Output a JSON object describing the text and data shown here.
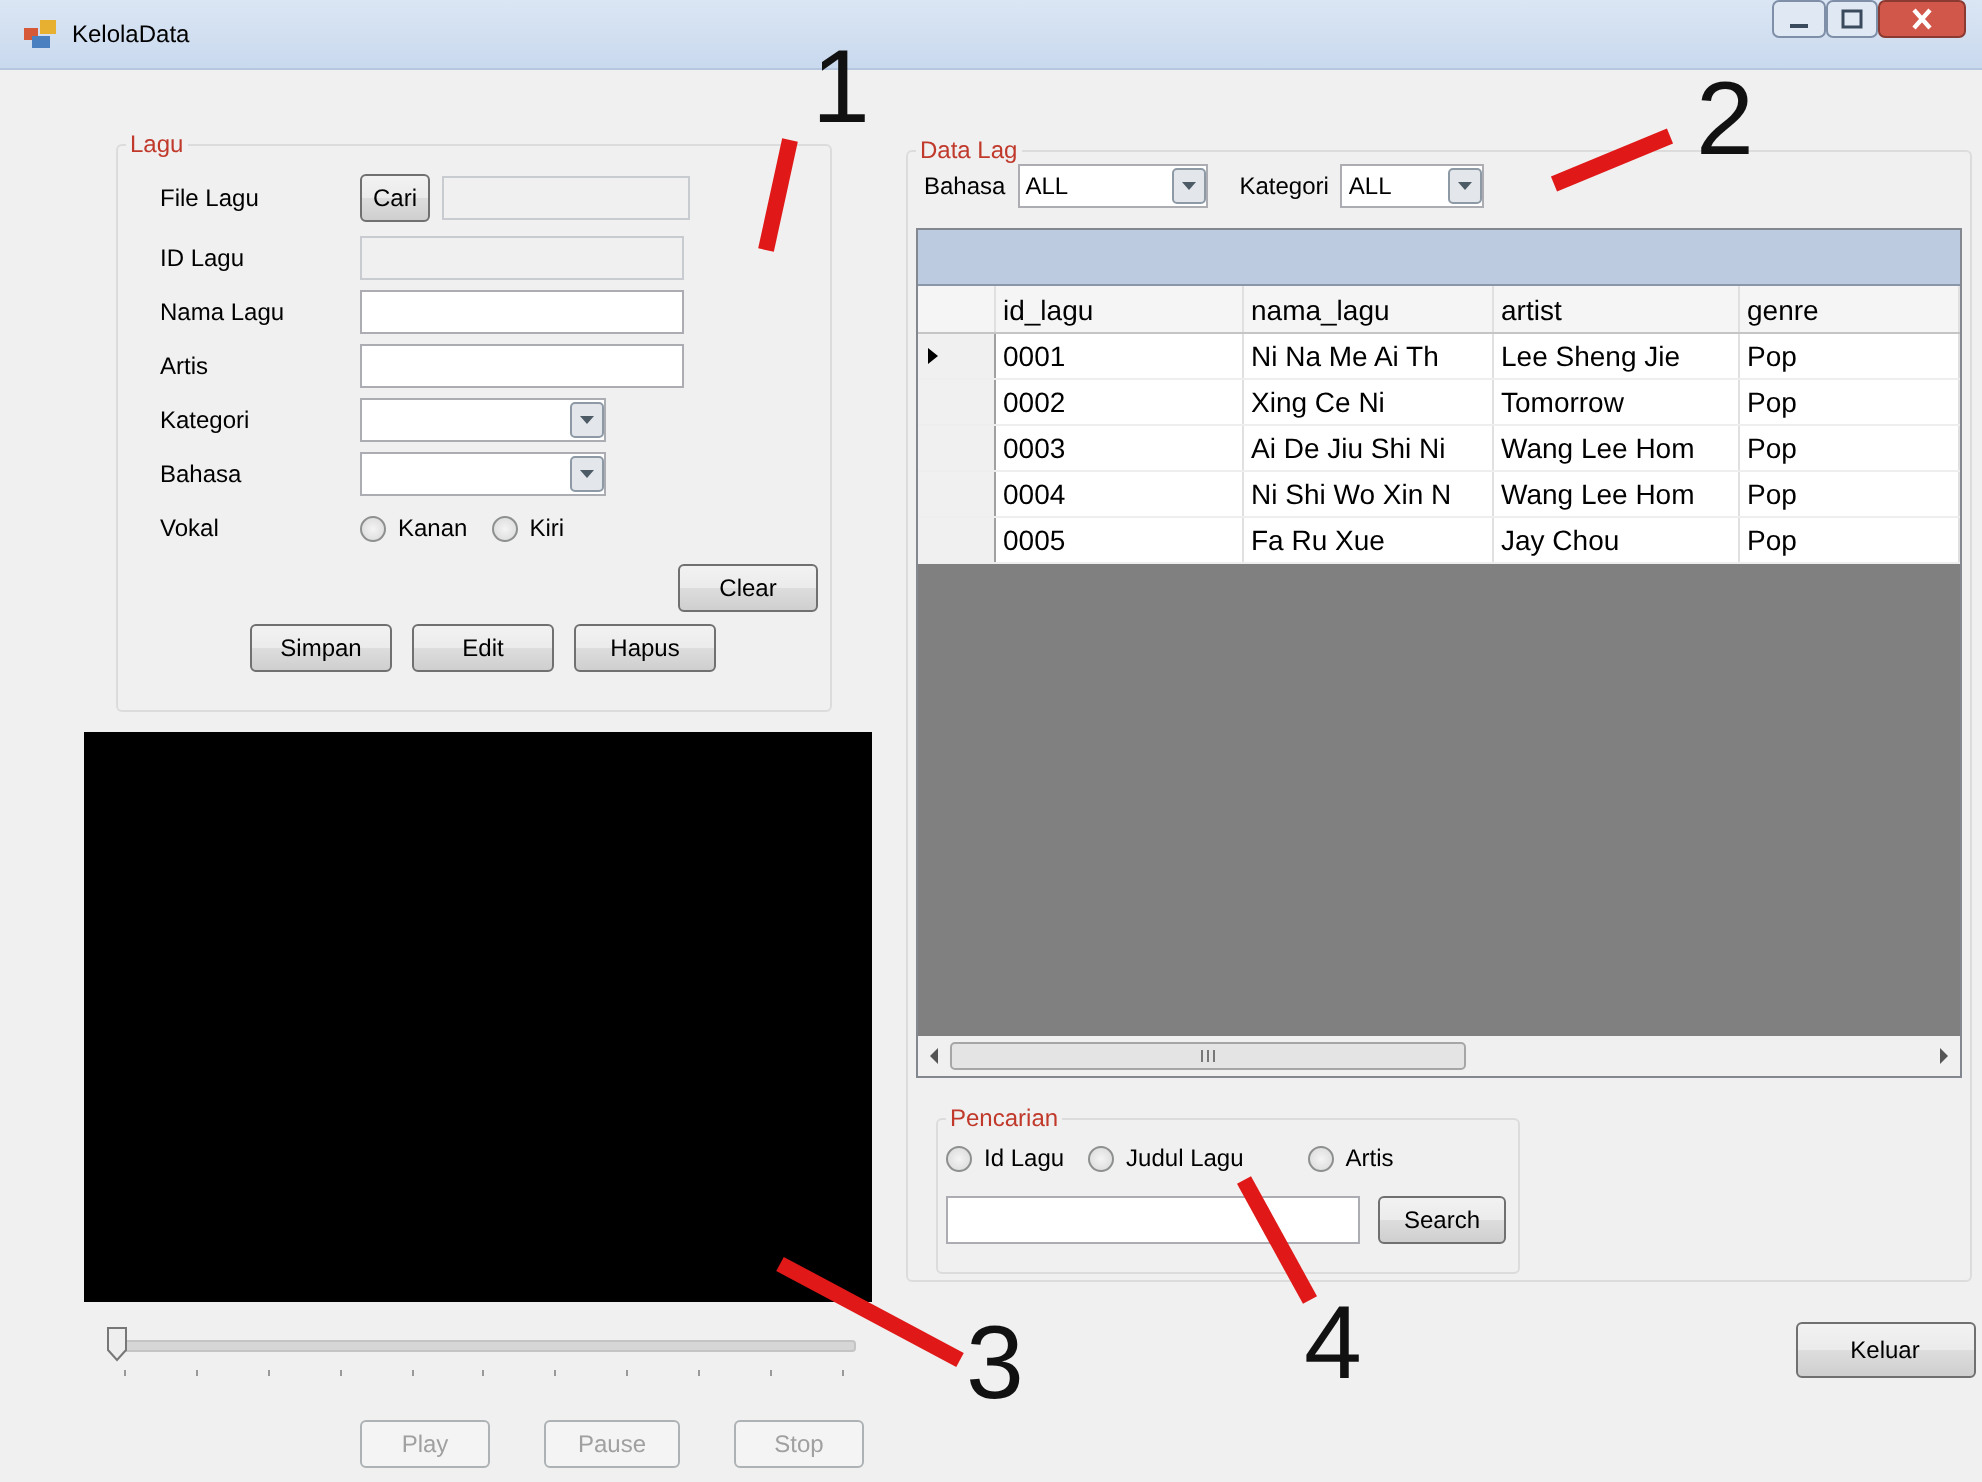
{
  "window": {
    "title": "KelolaData"
  },
  "lagu_group": {
    "title": "Lagu",
    "file_row": {
      "label": "File Lagu",
      "button": "Cari"
    },
    "fields": [
      {
        "label": "ID Lagu",
        "kind": "text",
        "disabled": true
      },
      {
        "label": "Nama Lagu",
        "kind": "text",
        "disabled": false
      },
      {
        "label": "Artis",
        "kind": "text",
        "disabled": false
      },
      {
        "label": "Kategori",
        "kind": "combo",
        "disabled": false
      },
      {
        "label": "Bahasa",
        "kind": "combo",
        "disabled": false
      }
    ],
    "vokal": {
      "label": "Vokal",
      "options": [
        {
          "label": "Kanan",
          "selected": false
        },
        {
          "label": "Kiri",
          "selected": false
        }
      ]
    },
    "clear_button": "Clear",
    "buttons": [
      "Simpan",
      "Edit",
      "Hapus"
    ]
  },
  "player": {
    "seek": {
      "level": 0
    },
    "buttons": [
      {
        "label": "Play",
        "disabled": true
      },
      {
        "label": "Pause",
        "disabled": true
      },
      {
        "label": "Stop",
        "disabled": true
      }
    ]
  },
  "data_group": {
    "title": "Data Lag",
    "filters": [
      {
        "label": "Bahasa",
        "value": "ALL"
      },
      {
        "label": "Kategori",
        "value": "ALL"
      }
    ],
    "table": {
      "columns": [
        "id_lagu",
        "nama_lagu",
        "artist",
        "genre"
      ],
      "rows": [
        {
          "cells": [
            "0001",
            "Ni Na Me Ai Th",
            "Lee Sheng Jie",
            "Pop"
          ],
          "selected": true
        },
        {
          "cells": [
            "0002",
            "Xing Ce Ni",
            "Tomorrow",
            "Pop"
          ],
          "selected": false
        },
        {
          "cells": [
            "0003",
            "Ai De Jiu Shi Ni",
            "Wang Lee Hom",
            "Pop"
          ],
          "selected": false
        },
        {
          "cells": [
            "0004",
            "Ni Shi Wo Xin N",
            "Wang Lee Hom",
            "Pop"
          ],
          "selected": false
        },
        {
          "cells": [
            "0005",
            "Fa Ru Xue",
            "Jay Chou",
            "Pop"
          ],
          "selected": false
        }
      ]
    }
  },
  "search_group": {
    "title": "Pencarian",
    "options": [
      {
        "label": "Id Lagu",
        "selected": false
      },
      {
        "label": "Judul Lagu",
        "selected": false
      },
      {
        "label": "Artis",
        "selected": false
      }
    ],
    "button": "Search"
  },
  "exit_button": "Keluar",
  "annotations": [
    {
      "label": "1"
    },
    {
      "label": "2"
    },
    {
      "label": "3"
    },
    {
      "label": "4"
    }
  ]
}
